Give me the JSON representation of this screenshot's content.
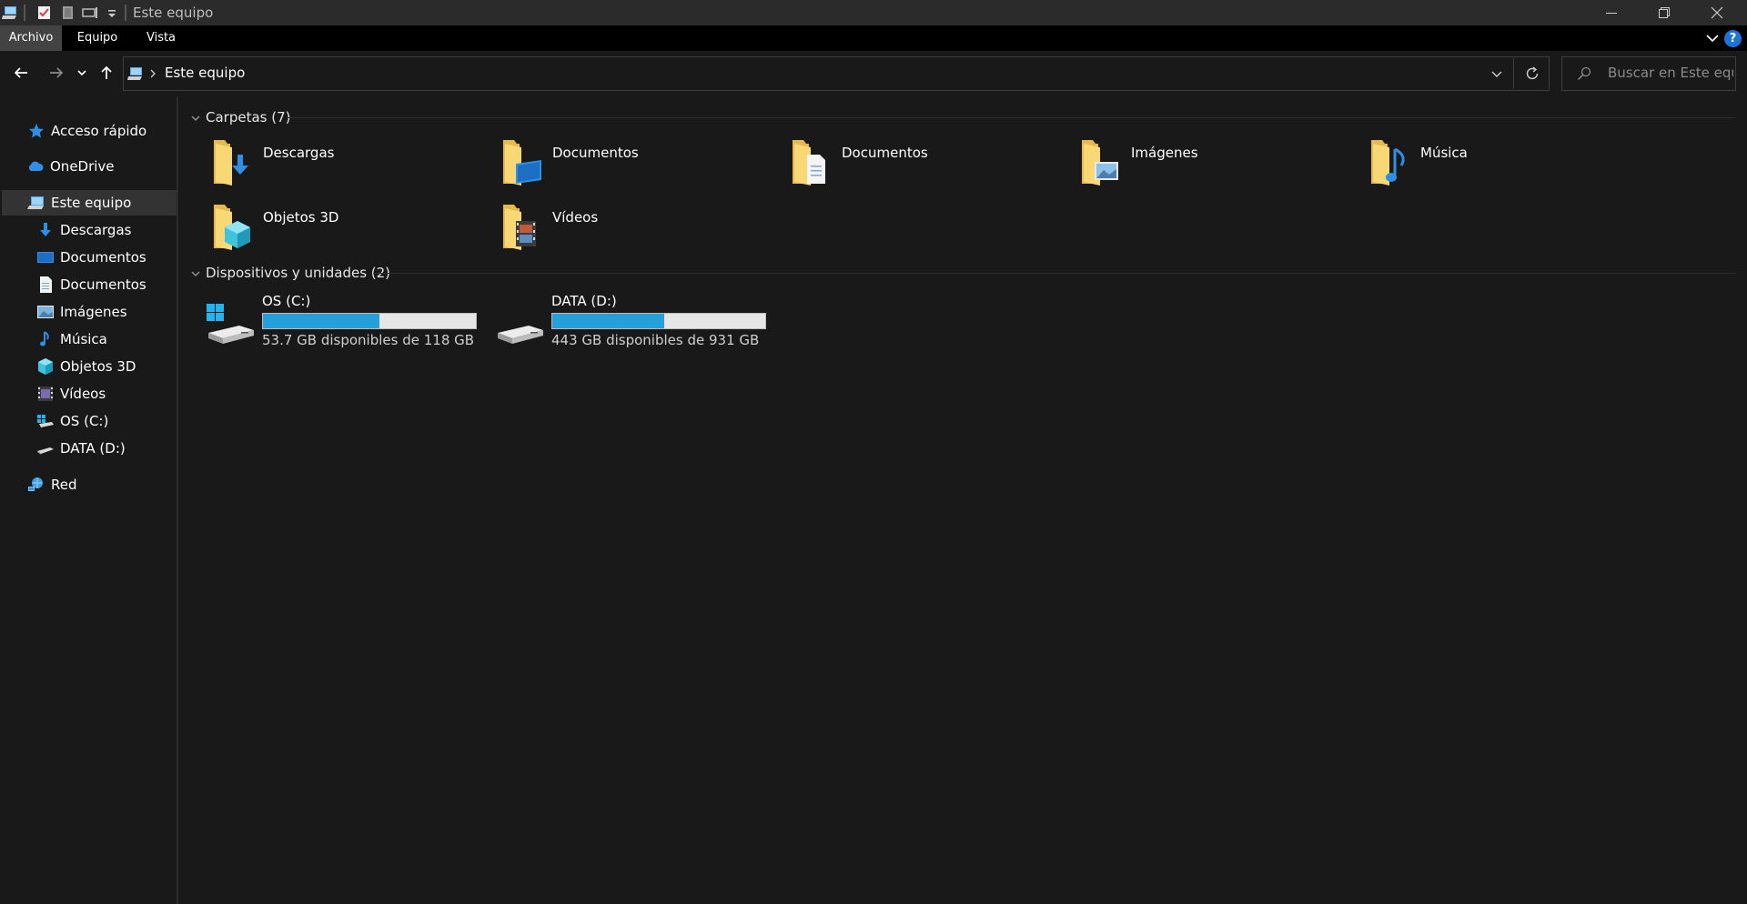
{
  "window": {
    "title": "Este equipo"
  },
  "ribbon": {
    "tabs": [
      {
        "label": "Archivo",
        "active": true
      },
      {
        "label": "Equipo",
        "active": false
      },
      {
        "label": "Vista",
        "active": false
      }
    ],
    "help_label": "?"
  },
  "address": {
    "path": "Este equipo",
    "search_placeholder": "Buscar en Este equipo"
  },
  "sidebar": {
    "items": [
      {
        "label": "Acceso rápido",
        "icon": "star-icon"
      },
      {
        "label": "OneDrive",
        "icon": "cloud-icon"
      },
      {
        "label": "Este equipo",
        "icon": "computer-icon",
        "selected": true
      },
      {
        "label": "Descargas",
        "icon": "download-icon"
      },
      {
        "label": "Documentos",
        "icon": "desktop-icon"
      },
      {
        "label": "Documentos",
        "icon": "document-icon"
      },
      {
        "label": "Imágenes",
        "icon": "picture-icon"
      },
      {
        "label": "Música",
        "icon": "music-icon"
      },
      {
        "label": "Objetos 3D",
        "icon": "cube-icon"
      },
      {
        "label": "Vídeos",
        "icon": "video-icon"
      },
      {
        "label": "OS (C:)",
        "icon": "windows-drive-icon"
      },
      {
        "label": "DATA (D:)",
        "icon": "drive-icon"
      },
      {
        "label": "Red",
        "icon": "network-icon"
      }
    ]
  },
  "folders_group": {
    "header": "Carpetas (7)",
    "items": [
      {
        "label": "Descargas",
        "icon": "downloads-folder-icon"
      },
      {
        "label": "Documentos",
        "icon": "desktop-folder-icon"
      },
      {
        "label": "Documentos",
        "icon": "documents-folder-icon"
      },
      {
        "label": "Imágenes",
        "icon": "pictures-folder-icon"
      },
      {
        "label": "Música",
        "icon": "music-folder-icon"
      },
      {
        "label": "Objetos 3D",
        "icon": "3d-objects-folder-icon"
      },
      {
        "label": "Vídeos",
        "icon": "videos-folder-icon"
      }
    ]
  },
  "devices_group": {
    "header": "Dispositivos y unidades (2)",
    "items": [
      {
        "name": "OS (C:)",
        "free_text": "53.7 GB disponibles de 118 GB",
        "used_fraction": 0.545,
        "icon": "windows-drive-icon"
      },
      {
        "name": "DATA (D:)",
        "free_text": "443 GB disponibles de 931 GB",
        "used_fraction": 0.524,
        "icon": "drive-icon"
      }
    ]
  },
  "colors": {
    "accent": "#26a0da",
    "background": "#191919",
    "titlebar": "#2b2b2b",
    "ribbon": "#000000",
    "folder_yellow": "#f8d775"
  }
}
